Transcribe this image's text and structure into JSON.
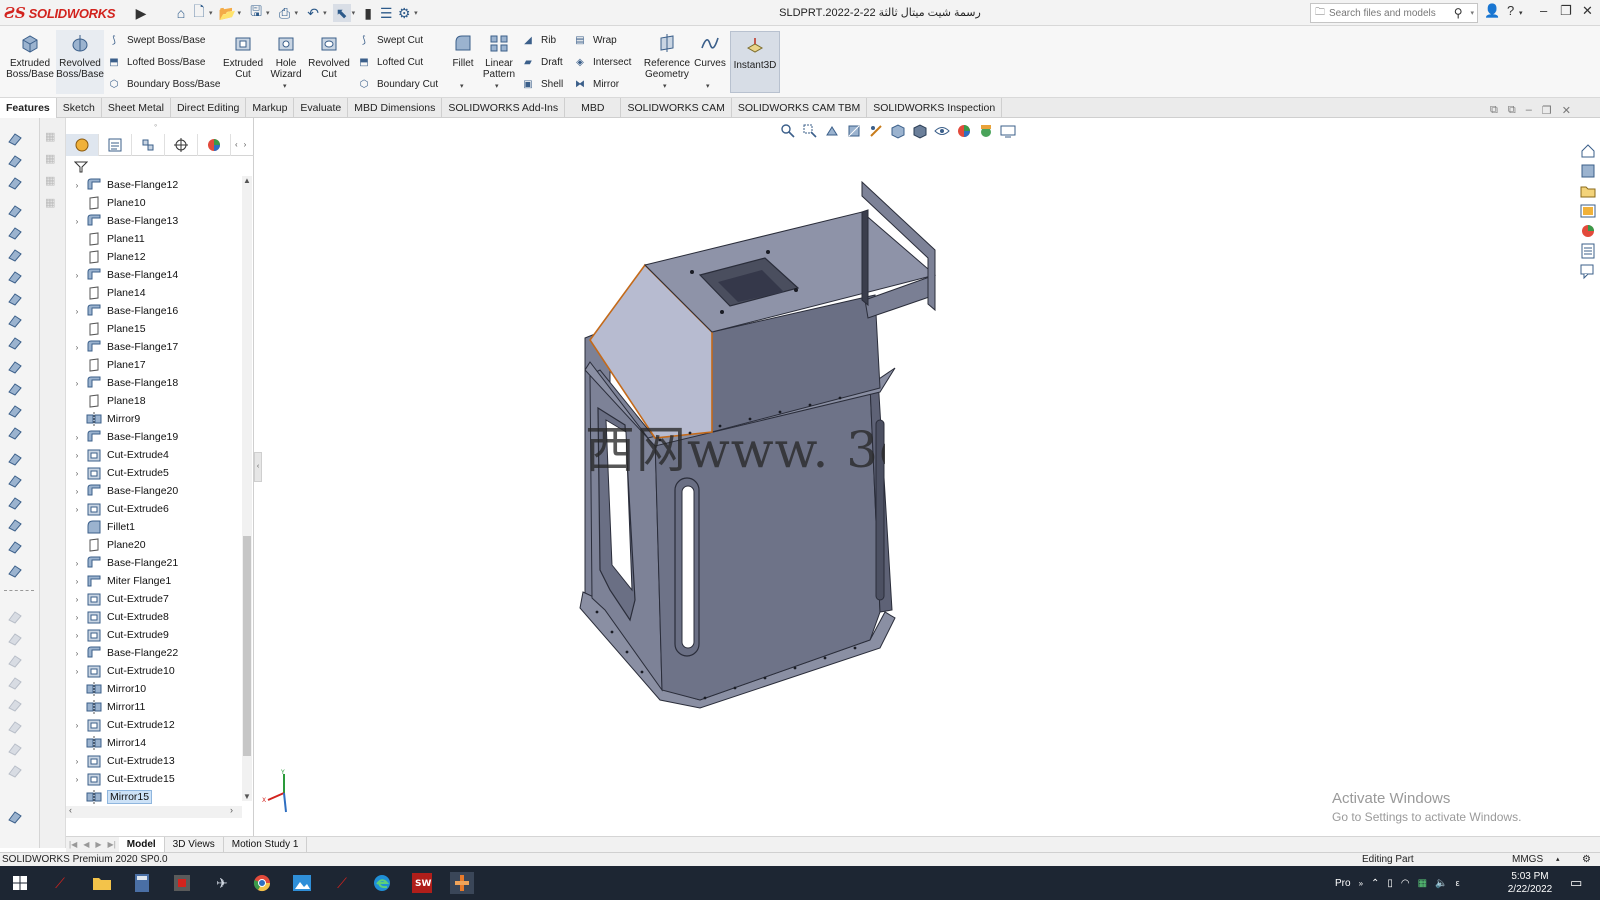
{
  "app": {
    "logo_text": "SOLIDWORKS",
    "document_title": "رسمة شيت ميتال ثالثة 22-2-2022.SLDPRT",
    "search_placeholder": "Search files and models"
  },
  "ribbon": {
    "big_buttons": [
      {
        "id": "extruded-boss",
        "label": "Extruded\nBoss/Base"
      },
      {
        "id": "revolved-boss",
        "label": "Revolved\nBoss/Base"
      },
      {
        "id": "extruded-cut",
        "label": "Extruded\nCut"
      },
      {
        "id": "hole-wizard",
        "label": "Hole\nWizard"
      },
      {
        "id": "revolved-cut",
        "label": "Revolved\nCut"
      },
      {
        "id": "fillet",
        "label": "Fillet"
      },
      {
        "id": "linear-pattern",
        "label": "Linear\nPattern"
      },
      {
        "id": "reference-geometry",
        "label": "Reference\nGeometry"
      },
      {
        "id": "curves",
        "label": "Curves"
      },
      {
        "id": "instant3d",
        "label": "Instant3D"
      }
    ],
    "small_buttons": {
      "swept_boss": "Swept Boss/Base",
      "lofted_boss": "Lofted Boss/Base",
      "boundary_boss": "Boundary Boss/Base",
      "swept_cut": "Swept Cut",
      "lofted_cut": "Lofted Cut",
      "boundary_cut": "Boundary Cut",
      "rib": "Rib",
      "draft": "Draft",
      "shell": "Shell",
      "wrap": "Wrap",
      "intersect": "Intersect",
      "mirror": "Mirror"
    }
  },
  "tabs": [
    "Features",
    "Sketch",
    "Sheet Metal",
    "Direct Editing",
    "Markup",
    "Evaluate",
    "MBD Dimensions",
    "SOLIDWORKS Add-Ins",
    "MBD",
    "SOLIDWORKS CAM",
    "SOLIDWORKS CAM TBM",
    "SOLIDWORKS Inspection"
  ],
  "active_tab": "Features",
  "tree": [
    {
      "label": "Base-Flange12",
      "type": "flange",
      "expand": true
    },
    {
      "label": "Plane10",
      "type": "plane",
      "expand": false
    },
    {
      "label": "Base-Flange13",
      "type": "flange",
      "expand": true
    },
    {
      "label": "Plane11",
      "type": "plane",
      "expand": false
    },
    {
      "label": "Plane12",
      "type": "plane",
      "expand": false
    },
    {
      "label": "Base-Flange14",
      "type": "flange",
      "expand": true
    },
    {
      "label": "Plane14",
      "type": "plane",
      "expand": false
    },
    {
      "label": "Base-Flange16",
      "type": "flange",
      "expand": true
    },
    {
      "label": "Plane15",
      "type": "plane",
      "expand": false
    },
    {
      "label": "Base-Flange17",
      "type": "flange",
      "expand": true
    },
    {
      "label": "Plane17",
      "type": "plane",
      "expand": false
    },
    {
      "label": "Base-Flange18",
      "type": "flange",
      "expand": true
    },
    {
      "label": "Plane18",
      "type": "plane",
      "expand": false
    },
    {
      "label": "Mirror9",
      "type": "mirror",
      "expand": false
    },
    {
      "label": "Base-Flange19",
      "type": "flange",
      "expand": true
    },
    {
      "label": "Cut-Extrude4",
      "type": "cut",
      "expand": true
    },
    {
      "label": "Cut-Extrude5",
      "type": "cut",
      "expand": true
    },
    {
      "label": "Base-Flange20",
      "type": "flange",
      "expand": true
    },
    {
      "label": "Cut-Extrude6",
      "type": "cut",
      "expand": true
    },
    {
      "label": "Fillet1",
      "type": "fillet",
      "expand": false
    },
    {
      "label": "Plane20",
      "type": "plane",
      "expand": false
    },
    {
      "label": "Base-Flange21",
      "type": "flange",
      "expand": true
    },
    {
      "label": "Miter Flange1",
      "type": "miter",
      "expand": true
    },
    {
      "label": "Cut-Extrude7",
      "type": "cut",
      "expand": true
    },
    {
      "label": "Cut-Extrude8",
      "type": "cut",
      "expand": true
    },
    {
      "label": "Cut-Extrude9",
      "type": "cut",
      "expand": true
    },
    {
      "label": "Base-Flange22",
      "type": "flange",
      "expand": true
    },
    {
      "label": "Cut-Extrude10",
      "type": "cut",
      "expand": true
    },
    {
      "label": "Mirror10",
      "type": "mirror",
      "expand": false
    },
    {
      "label": "Mirror11",
      "type": "mirror",
      "expand": false
    },
    {
      "label": "Cut-Extrude12",
      "type": "cut",
      "expand": true
    },
    {
      "label": "Mirror14",
      "type": "mirror",
      "expand": false
    },
    {
      "label": "Cut-Extrude13",
      "type": "cut",
      "expand": true
    },
    {
      "label": "Cut-Extrude15",
      "type": "cut",
      "expand": true
    },
    {
      "label": "Mirror15",
      "type": "mirror",
      "expand": false,
      "selected": true
    }
  ],
  "viewport": {
    "watermark": "西网www. 3dm",
    "activate_title": "Activate Windows",
    "activate_sub": "Go to Settings to activate Windows."
  },
  "bottom_tabs": [
    "Model",
    "3D Views",
    "Motion Study 1"
  ],
  "status": {
    "product": "SOLIDWORKS Premium 2020 SP0.0",
    "mode": "Editing Part",
    "units": "MMGS"
  },
  "taskbar": {
    "tray_label": "Pro",
    "time": "5:03 PM",
    "date": "2/22/2022"
  },
  "colors": {
    "brand_red": "#d2231e",
    "model_face": "#70758a",
    "model_face_light": "#b7bbd0",
    "selection_edge": "#c46a1a"
  }
}
